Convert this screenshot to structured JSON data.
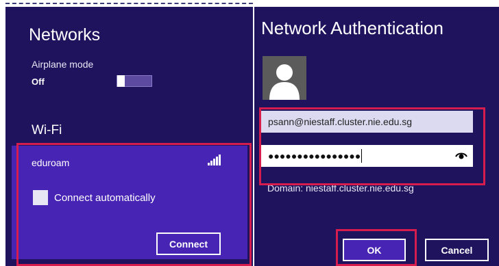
{
  "networks_panel": {
    "title": "Networks",
    "airplane_mode": {
      "label": "Airplane mode",
      "state": "Off"
    },
    "wifi_heading": "Wi-Fi",
    "network": {
      "ssid": "eduroam",
      "signal_icon": "wifi-signal-bars-icon",
      "connect_automatically_label": "Connect automatically",
      "connect_automatically_checked": false,
      "connect_button": "Connect"
    }
  },
  "auth_panel": {
    "title": "Network Authentication",
    "avatar_icon": "user-avatar-icon",
    "username_value": "psann@niestaff.cluster.nie.edu.sg",
    "password_mask": "●●●●●●●●●●●●●●●●",
    "reveal_icon": "eye-reveal-password-icon",
    "domain_text": "Domain: niestaff.cluster.nie.edu.sg",
    "ok_button": "OK",
    "cancel_button": "Cancel"
  },
  "colors": {
    "panel_background": "#20135e",
    "tile_background": "#4724b4",
    "highlight_border": "#d71c4e"
  }
}
